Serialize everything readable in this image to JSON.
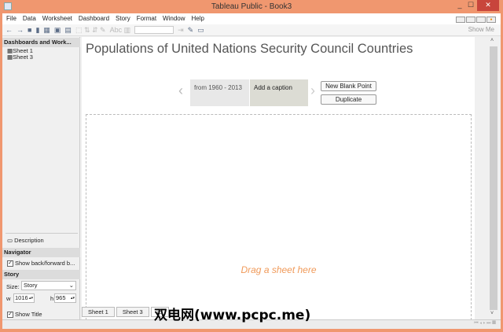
{
  "window": {
    "title": "Tableau Public - Book3",
    "minimize": "_",
    "maximize": "☐",
    "close": "✕"
  },
  "menu": [
    "File",
    "Data",
    "Worksheet",
    "Dashboard",
    "Story",
    "Format",
    "Window",
    "Help"
  ],
  "toolbar": {
    "show_me": "Show Me"
  },
  "left": {
    "dashboards_header": "Dashboards and Work...",
    "sheets": [
      "Sheet 1",
      "Sheet 3"
    ],
    "description": "Description",
    "navigator_header": "Navigator",
    "show_back_forward": "Show back/forward b...",
    "story_header": "Story",
    "size_label": "Size:",
    "size_value": "Story",
    "w_label": "w",
    "w_value": "1016",
    "h_label": "h",
    "h_value": "965",
    "show_title": "Show Title"
  },
  "story": {
    "title": "Populations of United Nations Security Council Countries",
    "points": [
      "from 1960 - 2013",
      "Add a caption"
    ],
    "new_blank_point": "New Blank Point",
    "duplicate": "Duplicate",
    "drop_hint": "Drag a sheet here"
  },
  "tabs": [
    "Sheet 1",
    "Sheet 3"
  ],
  "watermark": "双电网(www.pcpc.me)"
}
